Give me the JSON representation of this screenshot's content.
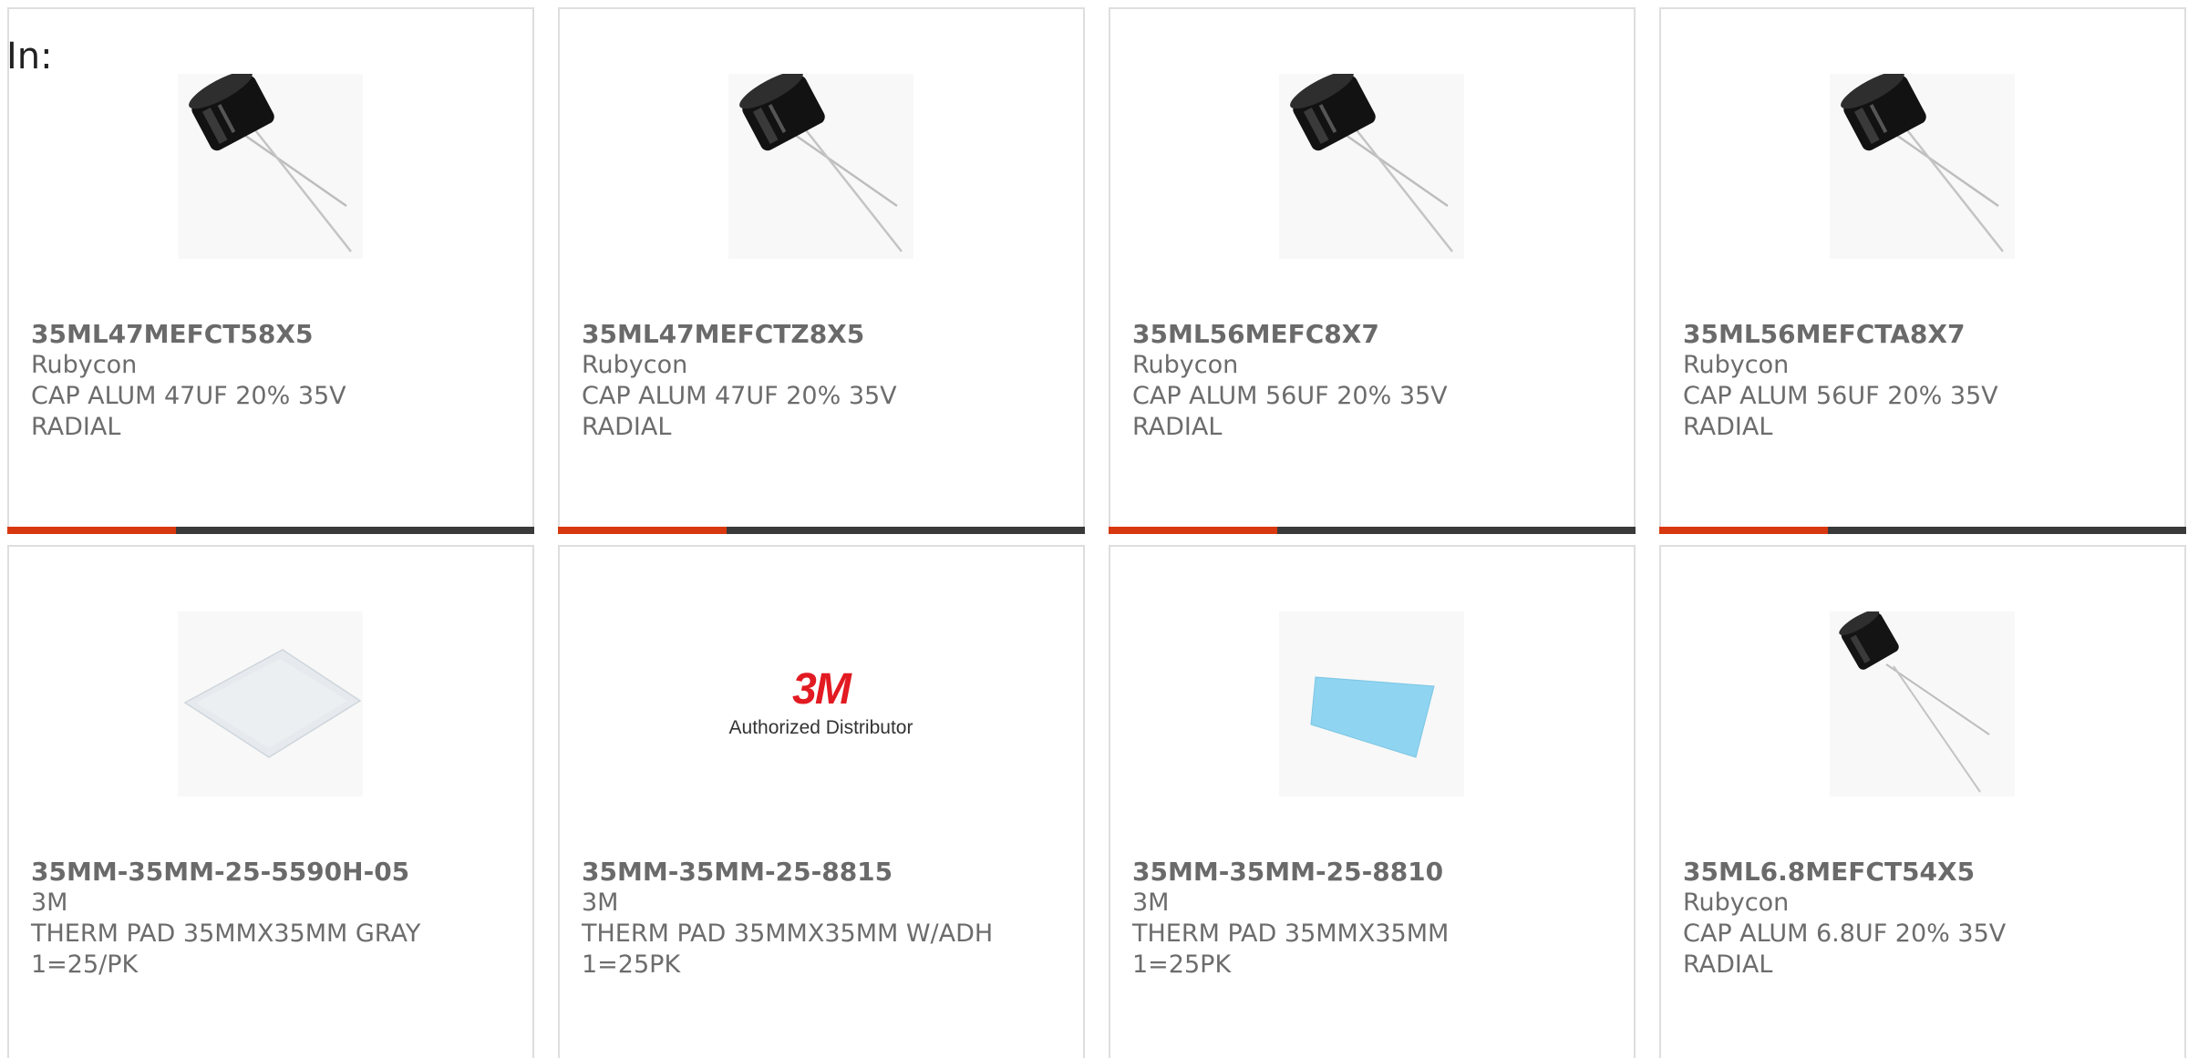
{
  "header": {
    "in_label": "In:"
  },
  "accent_color": "#d8380f",
  "bar_color": "#3a3a3a",
  "products": [
    {
      "part_number": "35ML47MEFCT58X5",
      "manufacturer": "Rubycon",
      "desc_line1": "CAP ALUM 47UF 20% 35V",
      "desc_line2": "RADIAL",
      "image": "radial-capacitor-image",
      "bar_accent_fraction": 0.32
    },
    {
      "part_number": "35ML47MEFCTZ8X5",
      "manufacturer": "Rubycon",
      "desc_line1": "CAP ALUM 47UF 20% 35V",
      "desc_line2": "RADIAL",
      "image": "radial-capacitor-image",
      "bar_accent_fraction": 0.32
    },
    {
      "part_number": "35ML56MEFC8X7",
      "manufacturer": "Rubycon",
      "desc_line1": "CAP ALUM 56UF 20% 35V",
      "desc_line2": "RADIAL",
      "image": "radial-capacitor-image",
      "bar_accent_fraction": 0.32
    },
    {
      "part_number": "35ML56MEFCTA8X7",
      "manufacturer": "Rubycon",
      "desc_line1": "CAP ALUM 56UF 20% 35V",
      "desc_line2": "RADIAL",
      "image": "radial-capacitor-image",
      "bar_accent_fraction": 0.32
    },
    {
      "part_number": "35MM-35MM-25-5590H-05",
      "manufacturer": "3M",
      "desc_line1": "THERM PAD 35MMX35MM GRAY",
      "desc_line2": "1=25/PK",
      "image": "gray-thermal-pad-image",
      "bar_accent_fraction": 0.32
    },
    {
      "part_number": "35MM-35MM-25-8815",
      "manufacturer": "3M",
      "desc_line1": "THERM PAD 35MMX35MM W/ADH",
      "desc_line2": "1=25PK",
      "image": "3m-logo-image",
      "logo_mark": "3M",
      "logo_sub": "Authorized Distributor",
      "bar_accent_fraction": 0.32
    },
    {
      "part_number": "35MM-35MM-25-8810",
      "manufacturer": "3M",
      "desc_line1": "THERM PAD 35MMX35MM",
      "desc_line2": "1=25PK",
      "image": "blue-thermal-pad-image",
      "bar_accent_fraction": 0.32
    },
    {
      "part_number": "35ML6.8MEFCT54X5",
      "manufacturer": "Rubycon",
      "desc_line1": "CAP ALUM 6.8UF 20% 35V",
      "desc_line2": "RADIAL",
      "image": "small-radial-capacitor-image",
      "bar_accent_fraction": 0.32
    }
  ]
}
